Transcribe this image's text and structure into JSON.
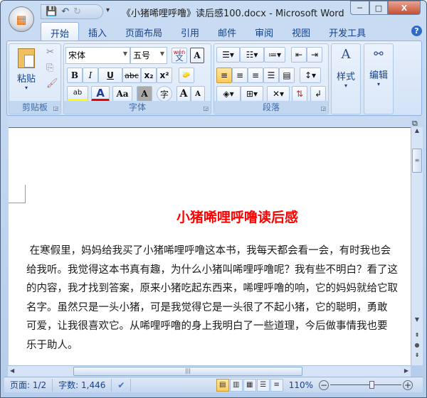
{
  "window": {
    "title": "《小猪唏哩呼噜》读后感100.docx - Microsoft Word",
    "minimize": "─",
    "maximize": "□",
    "close": "X"
  },
  "qat": {
    "save": "💾",
    "undo": "↶",
    "redo": "↻",
    "customize": "▾"
  },
  "tabs": [
    "开始",
    "插入",
    "页面布局",
    "引用",
    "邮件",
    "审阅",
    "视图",
    "开发工具"
  ],
  "help": "?",
  "ribbon": {
    "clipboard": {
      "label": "剪贴板",
      "paste": "粘贴"
    },
    "font": {
      "label": "字体",
      "font_name": "宋体",
      "font_size": "五号",
      "phonetic": "wén",
      "bold": "B",
      "italic": "I",
      "underline": "U",
      "strike": "abc",
      "subscript": "x₂",
      "superscript": "x²",
      "highlight": "ab",
      "font_color": "A",
      "change_case": "Aa",
      "char_shading": "A",
      "enclose": "字",
      "grow": "A",
      "shrink": "A"
    },
    "paragraph": {
      "label": "段落"
    },
    "styles": {
      "label": "样式"
    },
    "editing": {
      "label": "编辑"
    }
  },
  "document": {
    "title": "小猪唏哩呼噜读后感",
    "lines": [
      " 在寒假里，妈妈给我买了小猪唏哩呼噜这本书，我每天都会看一会，有时我也会",
      "给我听。我觉得这本书真有趣，为什么小猪叫唏哩呼噜呢？我有些不明白？看了这",
      "的内容，我才找到答案，原来小猪吃起东西来，唏哩呼噜的响，它的妈妈就给它取",
      "名字。虽然只是一头小猪，可是我觉得它是一头很了不起小猪，它的聪明，勇敢",
      "可爱，让我很喜欢它。从唏哩呼噜的身上我明白了一些道理，今后做事情我也要",
      "乐于助人。"
    ],
    "title_color": "#ff0000"
  },
  "status": {
    "page": "页面: 1/2",
    "words": "字数: 1,446",
    "zoom": "110%",
    "zoom_level": 110
  }
}
